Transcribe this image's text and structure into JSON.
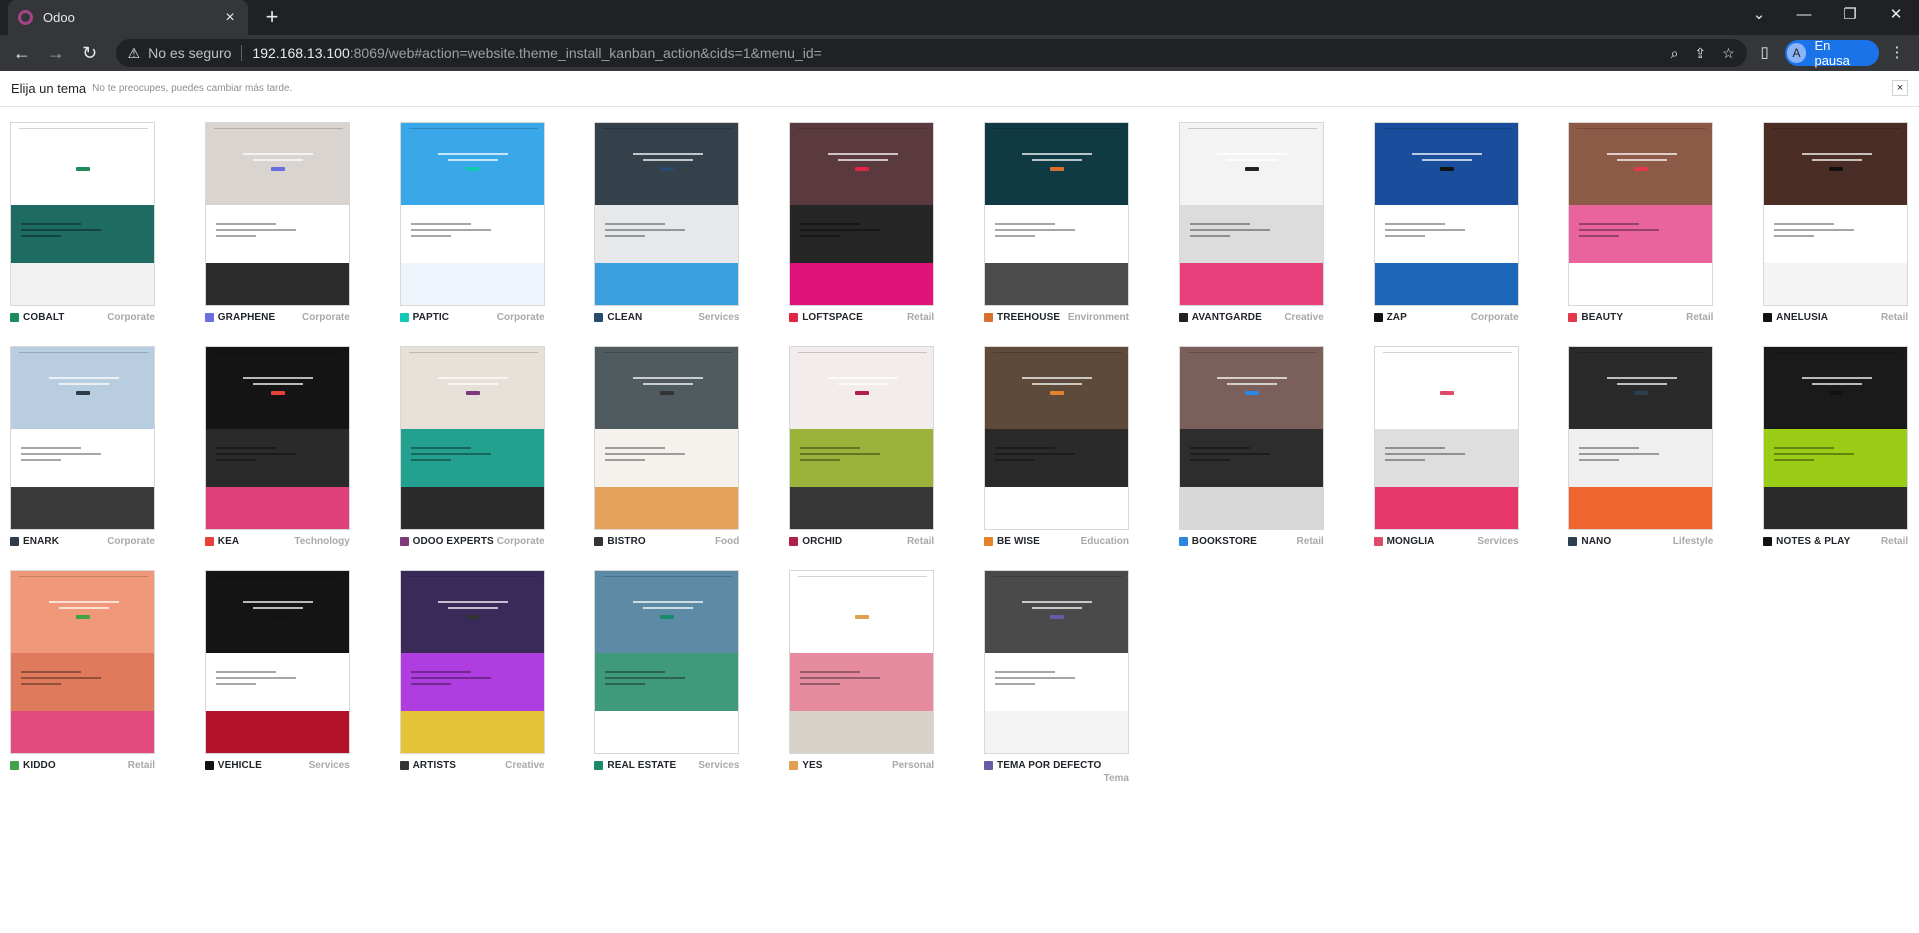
{
  "browser": {
    "tab_title": "Odoo",
    "tab_close": "×",
    "new_tab": "+",
    "insecure_label": "No es seguro",
    "url_host": "192.168.13.100",
    "url_rest": ":8069/web#action=website.theme_install_kanban_action&cids=1&menu_id=",
    "profile_initial": "A",
    "profile_label": "En pausa"
  },
  "header": {
    "title": "Elija un tema",
    "subtitle": "No te preocupes, puedes cambiar más tarde.",
    "close": "×"
  },
  "themes": [
    {
      "name": "COBALT",
      "category": "Corporate",
      "icon": "#1f8a5a",
      "colors": [
        "#ffffff",
        "#1e6b62",
        "#f1f1f1"
      ]
    },
    {
      "name": "GRAPHENE",
      "category": "Corporate",
      "icon": "#6b6ee0",
      "colors": [
        "#d9d4cf",
        "#ffffff",
        "#2c2c2c"
      ]
    },
    {
      "name": "PAPTIC",
      "category": "Corporate",
      "icon": "#11c9b6",
      "colors": [
        "#3aa7e8",
        "#ffffff",
        "#eef4fb"
      ]
    },
    {
      "name": "CLEAN",
      "category": "Services",
      "icon": "#274b6d",
      "colors": [
        "#34404a",
        "#e6e8ea",
        "#3aa0dd"
      ]
    },
    {
      "name": "LOFTSPACE",
      "category": "Retail",
      "icon": "#e02545",
      "colors": [
        "#5a3a3e",
        "#262626",
        "#e0137a"
      ]
    },
    {
      "name": "TREEHOUSE",
      "category": "Environment",
      "icon": "#d96f2e",
      "colors": [
        "#0f3a43",
        "#ffffff",
        "#4b4b4b"
      ]
    },
    {
      "name": "AVANTGARDE",
      "category": "Creative",
      "icon": "#222222",
      "colors": [
        "#f3f3f3",
        "#dcdcdc",
        "#e8407b"
      ]
    },
    {
      "name": "ZAP",
      "category": "Corporate",
      "icon": "#111111",
      "colors": [
        "#1a4e9c",
        "#ffffff",
        "#1d67b8"
      ]
    },
    {
      "name": "BEAUTY",
      "category": "Retail",
      "icon": "#e23a4a",
      "colors": [
        "#8e5a48",
        "#e9649c",
        "#ffffff"
      ]
    },
    {
      "name": "ANELUSIA",
      "category": "Retail",
      "icon": "#111111",
      "colors": [
        "#4a2d25",
        "#ffffff",
        "#f4f4f4"
      ]
    },
    {
      "name": "ENARK",
      "category": "Corporate",
      "icon": "#2f3c4a",
      "colors": [
        "#b8cde0",
        "#ffffff",
        "#3a3a3a"
      ]
    },
    {
      "name": "KEA",
      "category": "Technology",
      "icon": "#e8413b",
      "colors": [
        "#141414",
        "#2a2a2a",
        "#e0407a"
      ]
    },
    {
      "name": "ODOO EXPERTS",
      "category": "Corporate",
      "icon": "#7c3a78",
      "colors": [
        "#e6e0d8",
        "#23a08f",
        "#2b2b2b"
      ]
    },
    {
      "name": "BISTRO",
      "category": "Food",
      "icon": "#333333",
      "colors": [
        "#4f5b5e",
        "#f5f2ee",
        "#e4a25a"
      ]
    },
    {
      "name": "ORCHID",
      "category": "Retail",
      "icon": "#b0204a",
      "colors": [
        "#f3ecec",
        "#9bb33a",
        "#363636"
      ]
    },
    {
      "name": "BE WISE",
      "category": "Education",
      "icon": "#e3822a",
      "colors": [
        "#5e4a3a",
        "#2a2a2a",
        "#ffffff"
      ]
    },
    {
      "name": "BOOKSTORE",
      "category": "Retail",
      "icon": "#2a86e0",
      "colors": [
        "#7a5f5a",
        "#2d2d2d",
        "#d8d8d8"
      ]
    },
    {
      "name": "MONGLIA",
      "category": "Services",
      "icon": "#e04a6a",
      "colors": [
        "#ffffff",
        "#dedede",
        "#e7386c"
      ]
    },
    {
      "name": "NANO",
      "category": "Lifestyle",
      "icon": "#2c3e50",
      "colors": [
        "#2a2a2a",
        "#efefef",
        "#f0652f"
      ]
    },
    {
      "name": "NOTES & PLAY",
      "category": "Retail",
      "icon": "#111111",
      "colors": [
        "#1a1a1a",
        "#9ccd16",
        "#2a2a2a"
      ]
    },
    {
      "name": "KIDDO",
      "category": "Retail",
      "icon": "#3fa34a",
      "colors": [
        "#f0987a",
        "#e07a5c",
        "#e14b7e"
      ]
    },
    {
      "name": "VEHICLE",
      "category": "Services",
      "icon": "#111111",
      "colors": [
        "#141414",
        "#ffffff",
        "#b2132a"
      ]
    },
    {
      "name": "ARTISTS",
      "category": "Creative",
      "icon": "#333333",
      "colors": [
        "#3a2a5a",
        "#b03de0",
        "#e7c33a"
      ]
    },
    {
      "name": "REAL ESTATE",
      "category": "Services",
      "icon": "#1a8a6a",
      "colors": [
        "#5d8aa5",
        "#3f9a7c",
        "#ffffff"
      ]
    },
    {
      "name": "YES",
      "category": "Personal",
      "icon": "#e0a050",
      "colors": [
        "#ffffff",
        "#e68aa0",
        "#d8d2c8"
      ]
    },
    {
      "name": "TEMA POR DEFECTO",
      "category": "Tema",
      "icon": "#6b5aa8",
      "colors": [
        "#4a4a4a",
        "#ffffff",
        "#f4f4f4"
      ]
    }
  ]
}
